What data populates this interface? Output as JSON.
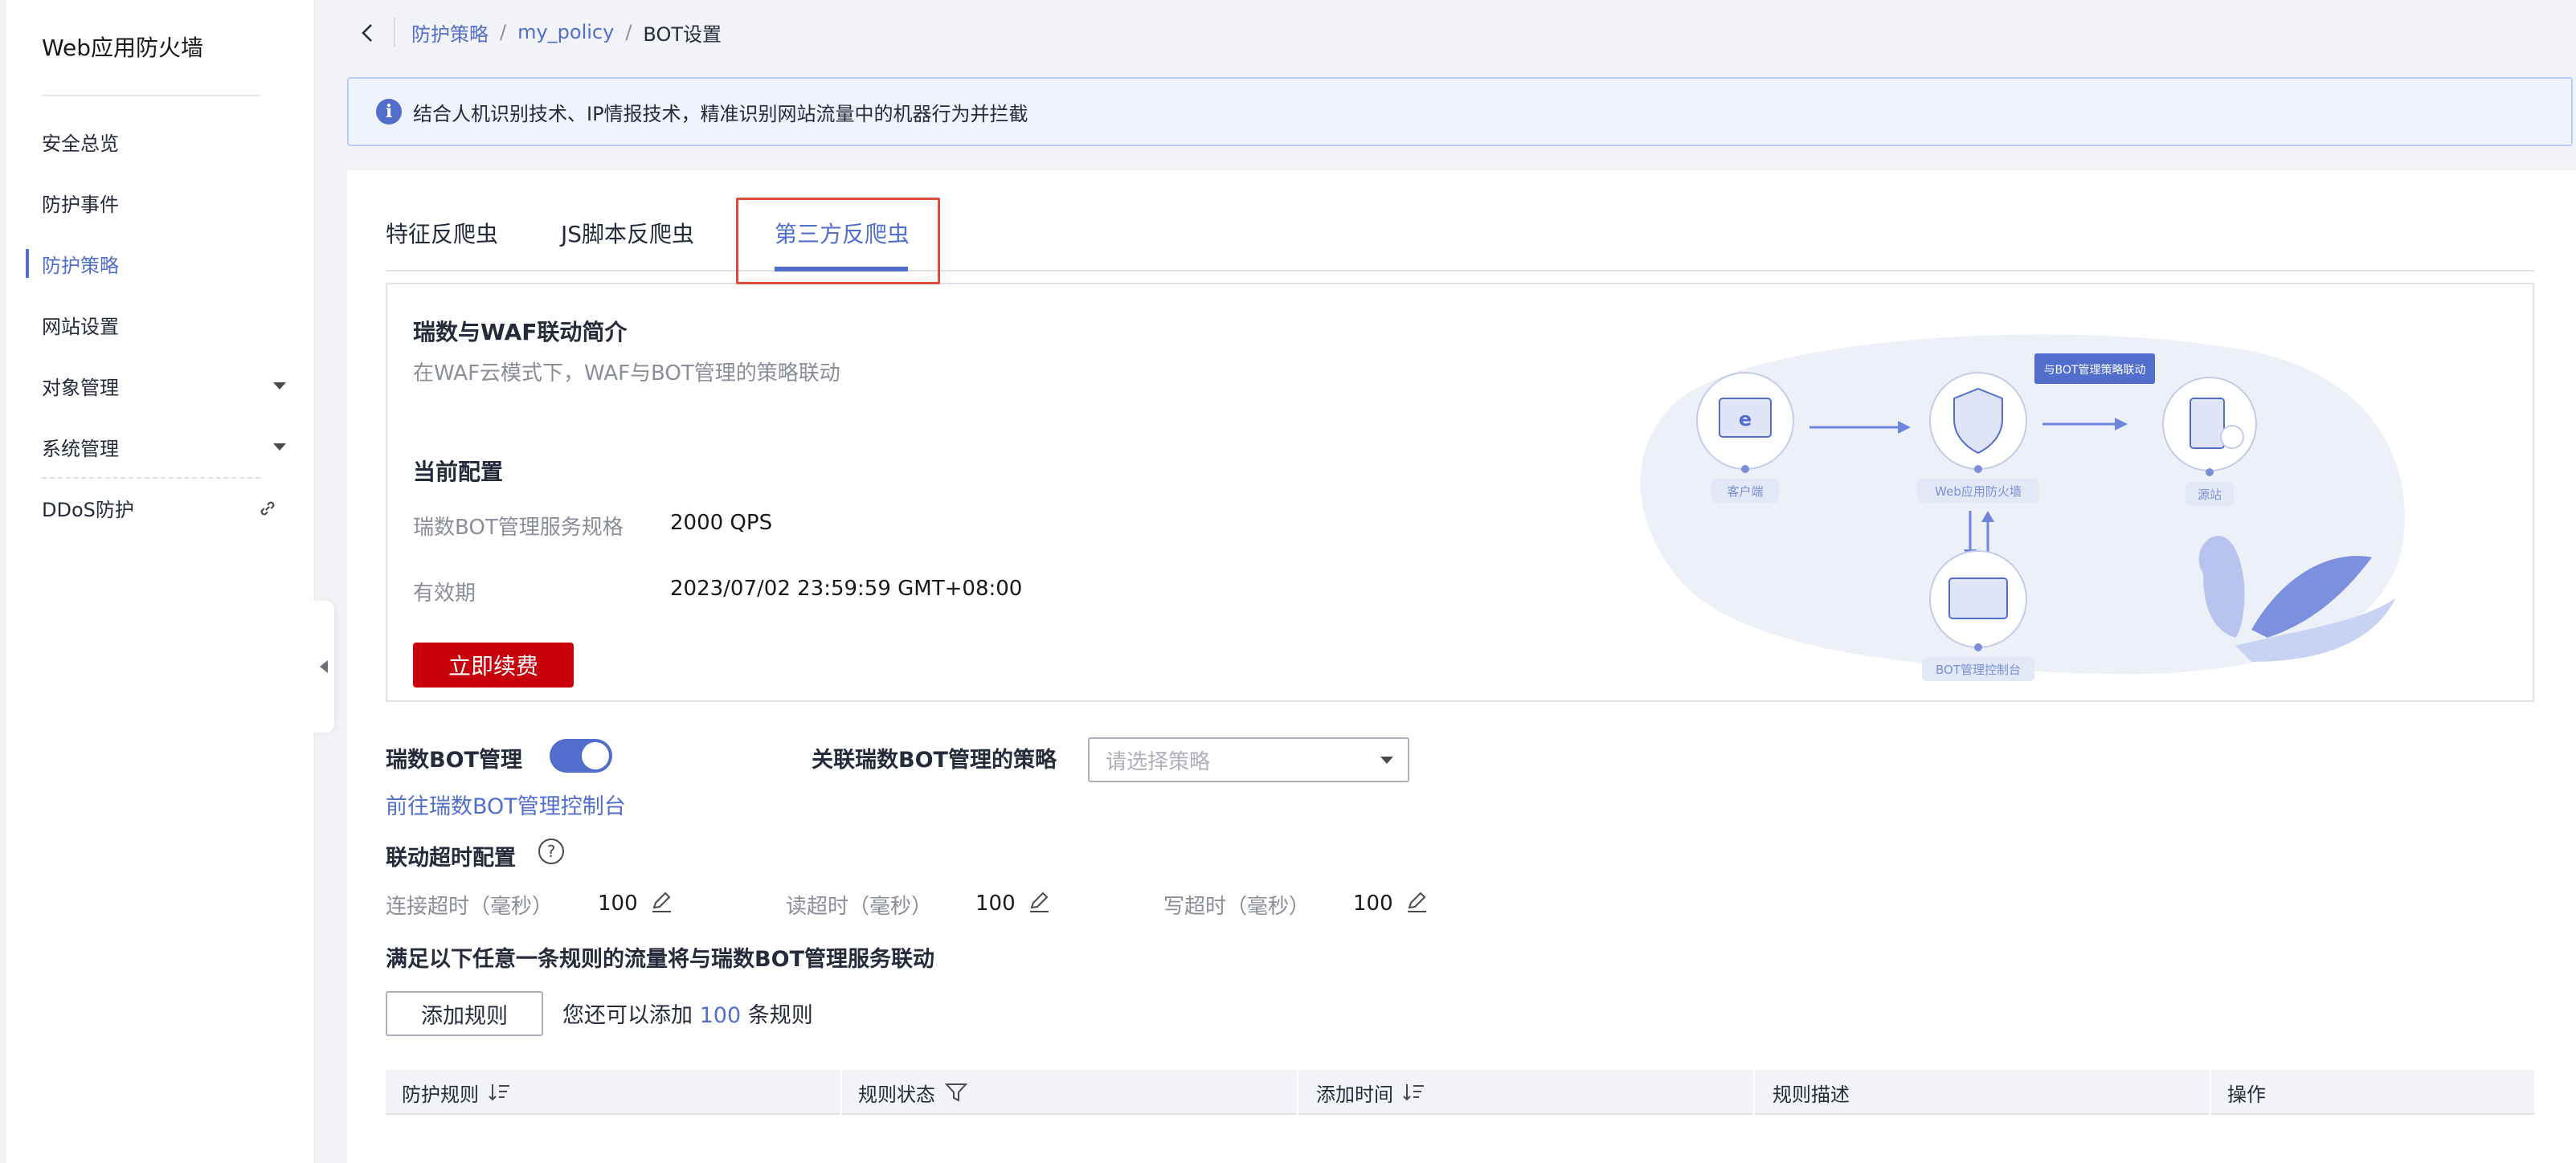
{
  "sidebar": {
    "title": "Web应用防火墙",
    "items": [
      {
        "label": "安全总览"
      },
      {
        "label": "防护事件"
      },
      {
        "label": "防护策略"
      },
      {
        "label": "网站设置"
      },
      {
        "label": "对象管理"
      },
      {
        "label": "系统管理"
      },
      {
        "label": "DDoS防护"
      }
    ]
  },
  "breadcrumb": {
    "level1": "防护策略",
    "level2": "my_policy",
    "current": "BOT设置",
    "separator": "/"
  },
  "banner": {
    "text": "结合人机识别技术、IP情报技术，精准识别网站流量中的机器行为并拦截"
  },
  "tabs": [
    {
      "label": "特征反爬虫"
    },
    {
      "label": "JS脚本反爬虫"
    },
    {
      "label": "第三方反爬虫"
    }
  ],
  "intro": {
    "title": "瑞数与WAF联动简介",
    "subtitle": "在WAF云模式下，WAF与BOT管理的策略联动",
    "config_title": "当前配置",
    "spec_label": "瑞数BOT管理服务规格",
    "spec_value": "2000 QPS",
    "validity_label": "有效期",
    "validity_value": "2023/07/02 23:59:59 GMT+08:00",
    "renew_button": "立即续费"
  },
  "illustration": {
    "client_label": "客户端",
    "waf_label": "Web应用防火墙",
    "origin_label": "源站",
    "bot_console_label": "BOT管理控制台",
    "linkage_tag": "与BOT管理策略联动"
  },
  "bot": {
    "label": "瑞数BOT管理",
    "enabled": true,
    "policy_label": "关联瑞数BOT管理的策略",
    "policy_placeholder": "请选择策略",
    "console_link": "前往瑞数BOT管理控制台"
  },
  "timeout": {
    "label": "联动超时配置",
    "help_glyph": "?",
    "connect_label": "连接超时（毫秒）",
    "connect_value": "100",
    "read_label": "读超时（毫秒）",
    "read_value": "100",
    "write_label": "写超时（毫秒）",
    "write_value": "100"
  },
  "rules": {
    "title": "满足以下任意一条规则的流量将与瑞数BOT管理服务联动",
    "add_button": "添加规则",
    "hint_prefix": "您还可以添加",
    "hint_count": "100",
    "hint_suffix": "条规则"
  },
  "table": {
    "columns": [
      {
        "label": "防护规则"
      },
      {
        "label": "规则状态"
      },
      {
        "label": "添加时间"
      },
      {
        "label": "规则描述"
      },
      {
        "label": "操作"
      }
    ]
  },
  "colors": {
    "accent": "#526ecc",
    "danger": "#c7000b",
    "highlight_border": "#e34a3a"
  }
}
